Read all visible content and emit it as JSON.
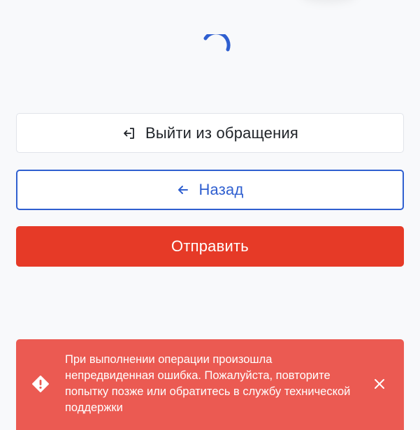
{
  "actions": {
    "exit_label": "Выйти из обращения",
    "back_label": "Назад",
    "send_label": "Отправить"
  },
  "error_toast": {
    "message": "При выполнении операции произошла непредвиденная ошибка. Пожалуйста, повторите попытку позже или обратитесь в службу технической поддержки"
  },
  "icons": {
    "spinner": "loading-spinner-icon",
    "exit": "logout-icon",
    "back": "arrow-left-icon",
    "warning": "warning-diamond-icon",
    "close": "close-icon"
  },
  "colors": {
    "background": "#f8f9fb",
    "spinner": "#2f5fd0",
    "back_accent": "#2f5fd0",
    "send_button": "#e63a27",
    "error_toast": "#eb5a52"
  }
}
